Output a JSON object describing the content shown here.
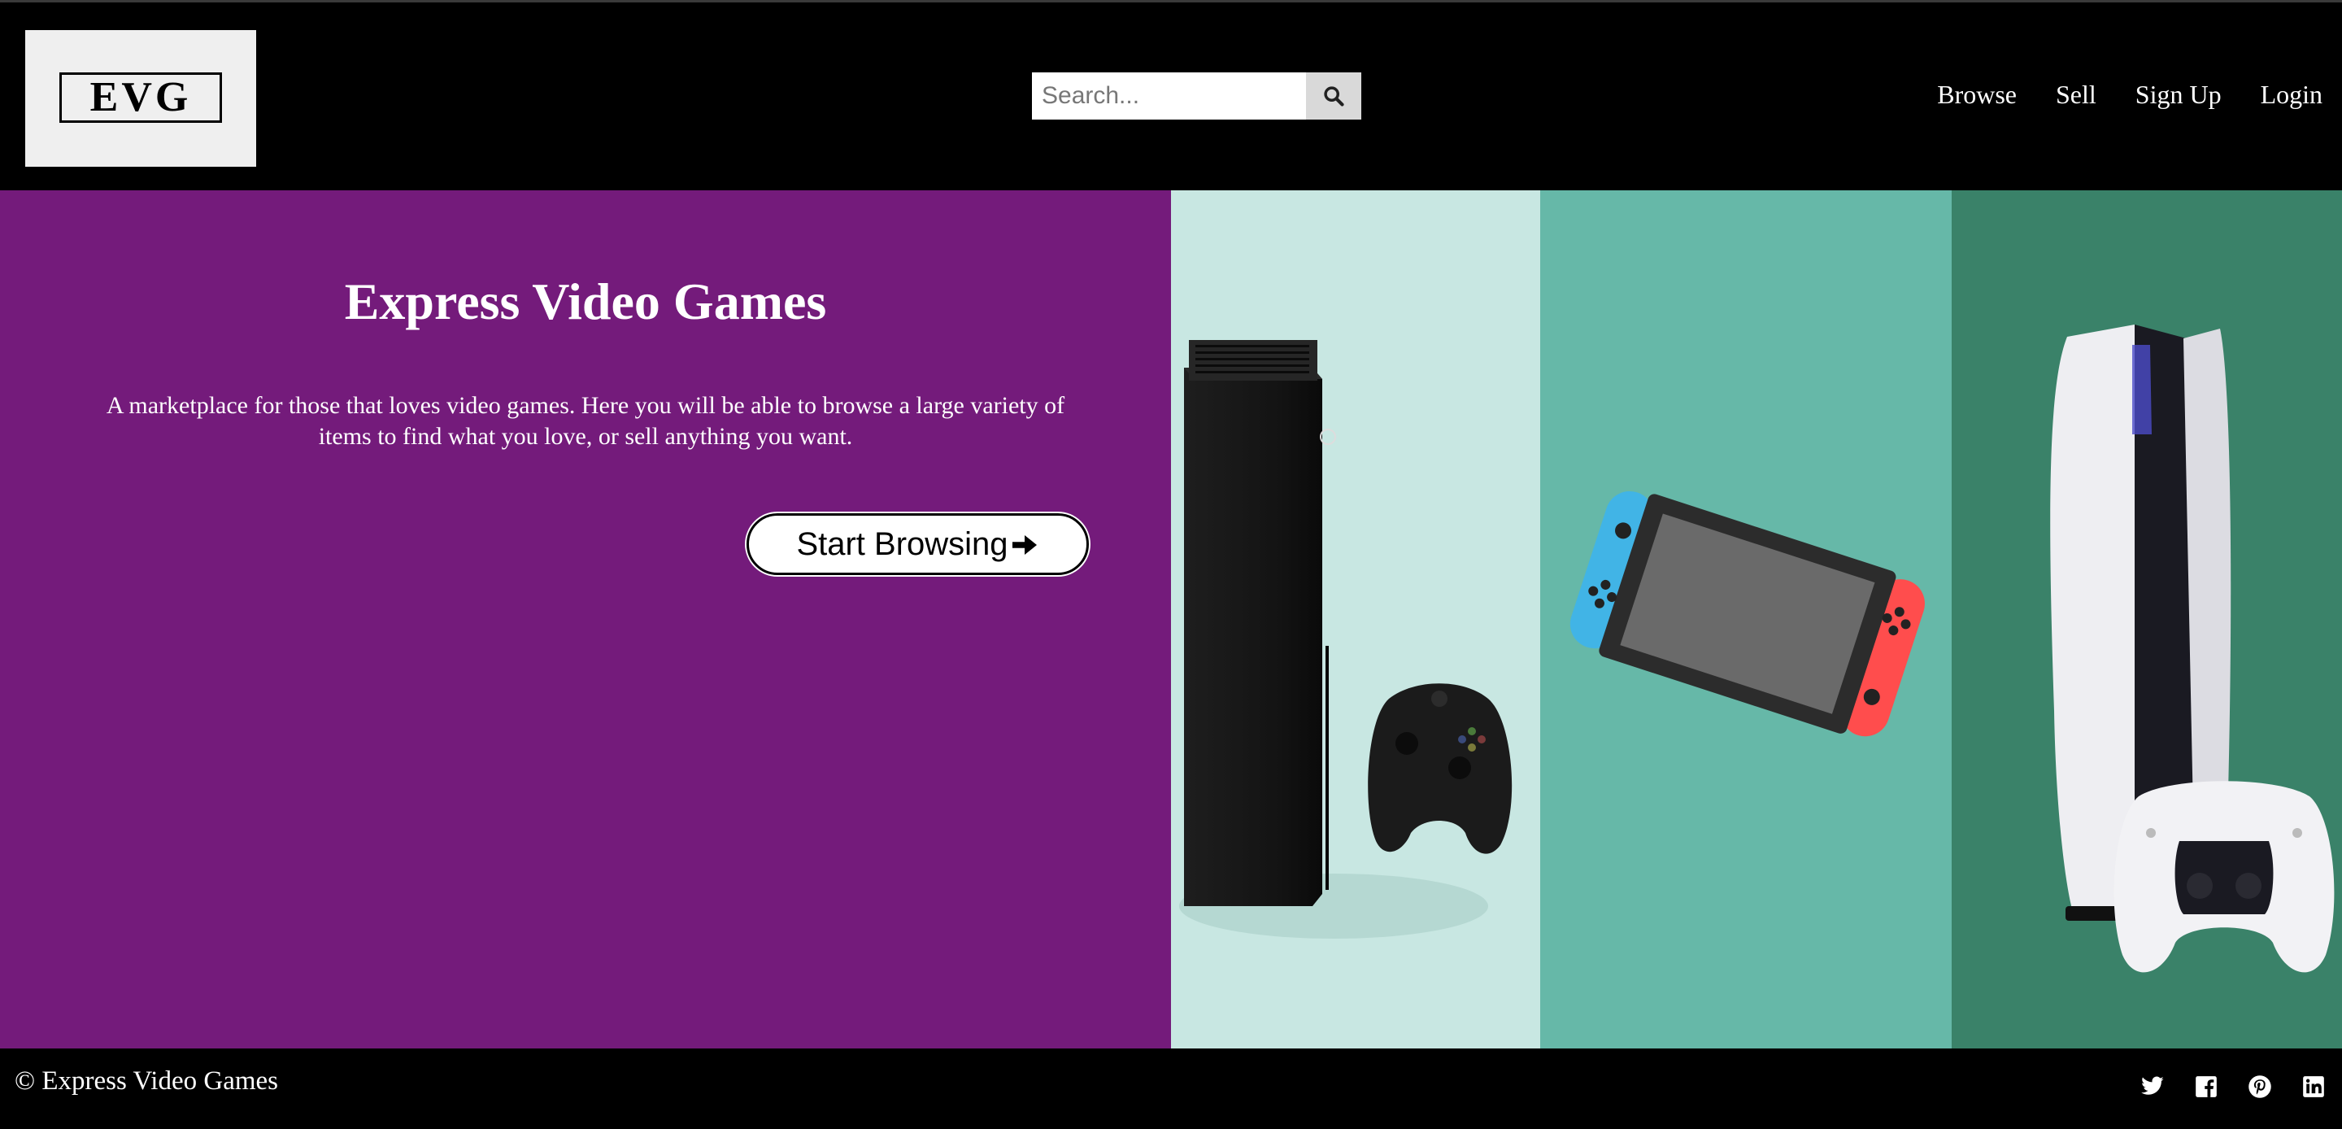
{
  "header": {
    "logo_text": "EVG",
    "search": {
      "placeholder": "Search...",
      "value": ""
    },
    "nav": [
      {
        "label": "Browse"
      },
      {
        "label": "Sell"
      },
      {
        "label": "Sign Up"
      },
      {
        "label": "Login"
      }
    ]
  },
  "hero": {
    "title": "Express Video Games",
    "description": "A marketplace for those that loves video games. Here you will be able to browse a large variety of items to find what you love, or sell anything you want.",
    "cta_label": "Start Browsing",
    "images": [
      "xbox-series-x-image",
      "nintendo-switch-image",
      "playstation-5-image"
    ],
    "colors": {
      "background": "#741b7b",
      "panel_1": "#c8e7e2",
      "panel_2": "#66b8a8",
      "panel_3": "#3a8269"
    }
  },
  "footer": {
    "copyright": "© Express Video Games",
    "socials": [
      "twitter-icon",
      "facebook-icon",
      "pinterest-icon",
      "linkedin-icon"
    ]
  }
}
